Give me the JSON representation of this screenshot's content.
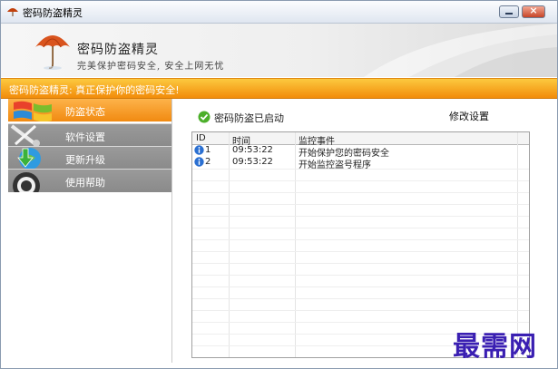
{
  "window": {
    "title": "密码防盗精灵",
    "minimize_label": "",
    "close_label": "×"
  },
  "header": {
    "app_name": "密码防盗精灵",
    "tagline": "完美保护密码安全, 安全上网无忧"
  },
  "banner": {
    "text": "密码防盗精灵: 真正保护你的密码安全!"
  },
  "sidebar": {
    "items": [
      {
        "label": "防盗状态",
        "icon": "windows-flag-icon",
        "active": true
      },
      {
        "label": "软件设置",
        "icon": "tools-icon",
        "active": false
      },
      {
        "label": "更新升级",
        "icon": "update-globe-icon",
        "active": false
      },
      {
        "label": "使用帮助",
        "icon": "help-lifebuoy-icon",
        "active": false
      }
    ]
  },
  "main": {
    "status_text": "密码防盗已启动",
    "status_icon": "green-check-icon",
    "settings_link": "修改设置",
    "log": {
      "columns": [
        "ID",
        "时间",
        "监控事件"
      ],
      "rows": [
        {
          "id": "1",
          "time": "09:53:22",
          "event": "开始保护您的密码安全",
          "icon": "info-icon"
        },
        {
          "id": "2",
          "time": "09:53:22",
          "event": "开始监控盗号程序",
          "icon": "info-icon"
        }
      ]
    }
  },
  "watermark": {
    "text": "最需网"
  },
  "colors": {
    "accent_orange": "#f28c0a",
    "sidebar_gray": "#8f8f8f",
    "watermark_purple": "#3a1fb2"
  }
}
